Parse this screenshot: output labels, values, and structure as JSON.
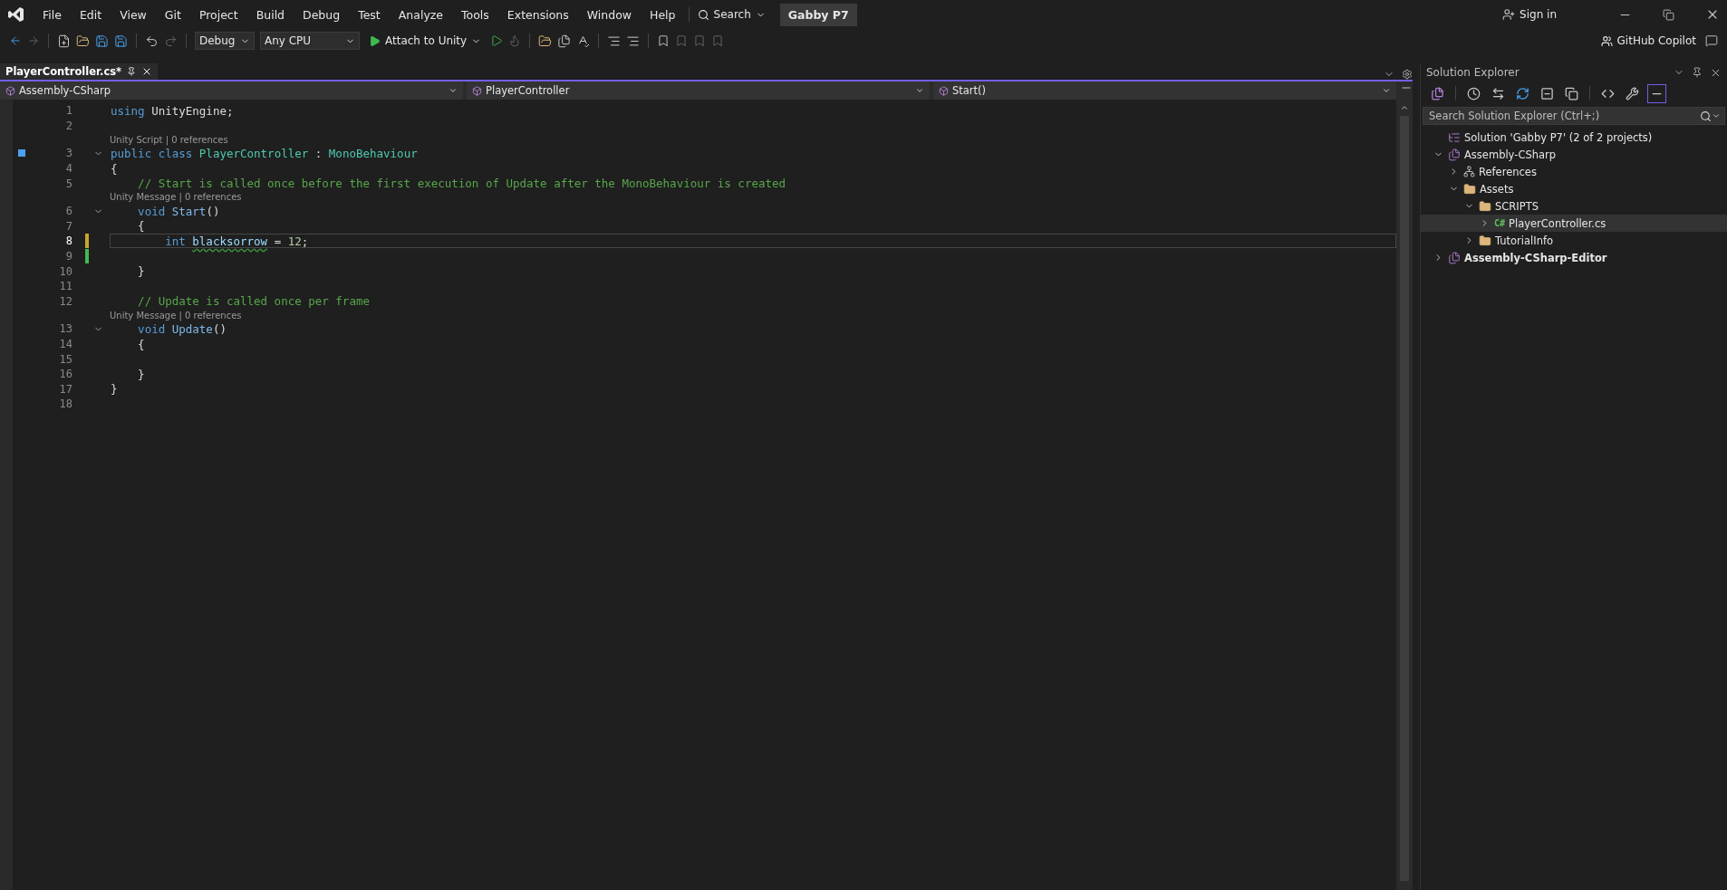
{
  "menu": [
    "File",
    "Edit",
    "View",
    "Git",
    "Project",
    "Build",
    "Debug",
    "Test",
    "Analyze",
    "Tools",
    "Extensions",
    "Window",
    "Help"
  ],
  "search": {
    "label": "Search"
  },
  "solution_name": "Gabby P7",
  "account": {
    "label": "Sign in"
  },
  "toolbar": {
    "configuration": "Debug",
    "platform": "Any CPU",
    "run": "Attach to Unity",
    "copilot": "GitHub Copilot"
  },
  "tabs": [
    {
      "label": "PlayerController.cs*",
      "selected": true
    }
  ],
  "navigation": [
    "Assembly-CSharp",
    "PlayerController",
    "Start()"
  ],
  "code": [
    {
      "number": "1",
      "tokens": [
        {
          "kind": "kw",
          "text": "using"
        },
        {
          "kind": "plain",
          "text": " UnityEngine;"
        }
      ]
    },
    {
      "number": "2"
    },
    {
      "number": "3",
      "lens": "Unity Script | 0 references",
      "fold": true,
      "gutter_icon": true,
      "tokens": [
        {
          "kind": "kw",
          "text": "public class "
        },
        {
          "kind": "type",
          "text": "PlayerController"
        },
        {
          "kind": "plain",
          "text": " : "
        },
        {
          "kind": "type",
          "text": "MonoBehaviour"
        }
      ]
    },
    {
      "number": "4",
      "tokens": [
        {
          "kind": "plain",
          "text": "{"
        }
      ]
    },
    {
      "number": "5",
      "tokens": [
        {
          "kind": "comment",
          "text": "    // Start is called once before the first execution of Update after the MonoBehaviour is created"
        }
      ]
    },
    {
      "number": "6",
      "lens": "Unity Message | 0 references",
      "fold": true,
      "tokens": [
        {
          "kind": "kw",
          "text": "    void "
        },
        {
          "kind": "method",
          "text": "Start"
        },
        {
          "kind": "plain",
          "text": "()"
        }
      ]
    },
    {
      "number": "7",
      "tokens": [
        {
          "kind": "plain",
          "text": "    {"
        }
      ]
    },
    {
      "number": "8",
      "current": true,
      "modified": true,
      "saved": false,
      "tokens": [
        {
          "kind": "kw",
          "text": "        int "
        },
        {
          "kind": "local",
          "text": "blacksorrow",
          "squiggle": true
        },
        {
          "kind": "plain",
          "text": " = "
        },
        {
          "kind": "number",
          "text": "12"
        },
        {
          "kind": "plain",
          "text": ";"
        }
      ]
    },
    {
      "number": "9",
      "modified": true,
      "saved": true
    },
    {
      "number": "10",
      "tokens": [
        {
          "kind": "plain",
          "text": "    }"
        }
      ]
    },
    {
      "number": "11"
    },
    {
      "number": "12",
      "tokens": [
        {
          "kind": "comment",
          "text": "    // Update is called once per frame"
        }
      ]
    },
    {
      "number": "13",
      "lens": "Unity Message | 0 references",
      "fold": true,
      "tokens": [
        {
          "kind": "kw",
          "text": "    void "
        },
        {
          "kind": "method",
          "text": "Update"
        },
        {
          "kind": "plain",
          "text": "()"
        }
      ]
    },
    {
      "number": "14",
      "tokens": [
        {
          "kind": "plain",
          "text": "    {"
        }
      ]
    },
    {
      "number": "15"
    },
    {
      "number": "16",
      "tokens": [
        {
          "kind": "plain",
          "text": "    }"
        }
      ]
    },
    {
      "number": "17",
      "tokens": [
        {
          "kind": "plain",
          "text": "}"
        }
      ]
    },
    {
      "number": "18"
    }
  ],
  "solution_explorer": {
    "title": "Solution Explorer",
    "search": {
      "placeholder": "Search Solution Explorer (Ctrl+;)"
    },
    "tree": [
      {
        "kind": "solution",
        "label": "Solution 'Gabby P7' (2 of 2 projects)",
        "selected": false,
        "children": [
          {
            "kind": "project",
            "label": "Assembly-CSharp",
            "expanded": true,
            "selected": false,
            "children": [
              {
                "kind": "references",
                "label": "References",
                "expanded": false,
                "selected": false
              },
              {
                "kind": "folder",
                "label": "Assets",
                "expanded": true,
                "selected": false,
                "children": [
                  {
                    "kind": "folder",
                    "label": "SCRIPTS",
                    "expanded": true,
                    "selected": false,
                    "children": [
                      {
                        "kind": "file",
                        "badge": "C#",
                        "label": "PlayerController.cs",
                        "expanded": false,
                        "selected": true
                      }
                    ]
                  },
                  {
                    "kind": "folder",
                    "label": "TutorialInfo",
                    "expanded": false,
                    "selected": false
                  }
                ]
              }
            ]
          },
          {
            "kind": "project",
            "label": "Assembly-CSharp-Editor",
            "bold": true,
            "expanded": false,
            "selected": false
          }
        ]
      }
    ]
  }
}
